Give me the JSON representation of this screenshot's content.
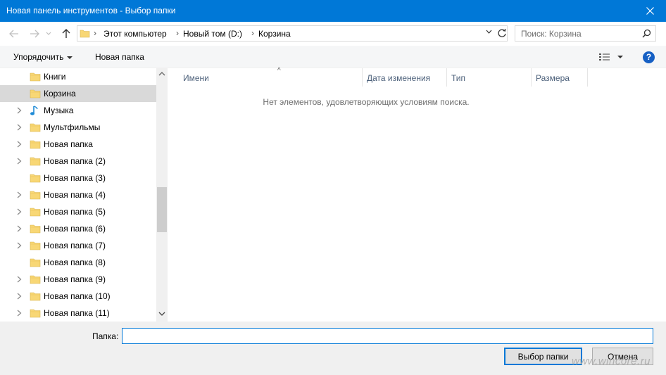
{
  "window": {
    "title": "Новая панель инструментов - Выбор папки"
  },
  "address": {
    "breadcrumbs": [
      "Этот компьютер",
      "Новый том (D:)",
      "Корзина"
    ]
  },
  "search": {
    "placeholder": "Поиск: Корзина"
  },
  "toolbar": {
    "organize_label": "Упорядочить",
    "new_folder_label": "Новая папка"
  },
  "nav": {
    "items": [
      {
        "label": "Книги",
        "icon": "folder-icon",
        "expandable": false,
        "selected": false
      },
      {
        "label": "Корзина",
        "icon": "folder-icon",
        "expandable": false,
        "selected": true
      },
      {
        "label": "Музыка",
        "icon": "music-note-icon",
        "expandable": true,
        "selected": false
      },
      {
        "label": "Мультфильмы",
        "icon": "folder-icon",
        "expandable": true,
        "selected": false
      },
      {
        "label": "Новая папка",
        "icon": "folder-icon",
        "expandable": true,
        "selected": false
      },
      {
        "label": "Новая папка (2)",
        "icon": "folder-icon",
        "expandable": true,
        "selected": false
      },
      {
        "label": "Новая папка (3)",
        "icon": "folder-icon",
        "expandable": false,
        "selected": false
      },
      {
        "label": "Новая папка (4)",
        "icon": "folder-icon",
        "expandable": true,
        "selected": false
      },
      {
        "label": "Новая папка (5)",
        "icon": "folder-icon",
        "expandable": true,
        "selected": false
      },
      {
        "label": "Новая папка (6)",
        "icon": "folder-icon",
        "expandable": true,
        "selected": false
      },
      {
        "label": "Новая папка (7)",
        "icon": "folder-icon",
        "expandable": true,
        "selected": false
      },
      {
        "label": "Новая папка (8)",
        "icon": "folder-icon",
        "expandable": false,
        "selected": false
      },
      {
        "label": "Новая папка (9)",
        "icon": "folder-icon",
        "expandable": true,
        "selected": false
      },
      {
        "label": "Новая папка (10)",
        "icon": "folder-icon",
        "expandable": true,
        "selected": false
      },
      {
        "label": "Новая папка (11)",
        "icon": "folder-icon",
        "expandable": true,
        "selected": false
      }
    ]
  },
  "columns": [
    "Имени",
    "Дата изменения",
    "Тип",
    "Размера"
  ],
  "empty_message": "Нет элементов, удовлетворяющих условиям поиска.",
  "footer": {
    "folder_label": "Папка:",
    "folder_value": "",
    "select_button": "Выбор папки",
    "cancel_button": "Отмена",
    "watermark": "www.wincore.ru"
  },
  "colors": {
    "titlebar": "#0078d7",
    "selection": "#d9d9d9",
    "folder": "#f8d775",
    "accent": "#0078d7"
  }
}
